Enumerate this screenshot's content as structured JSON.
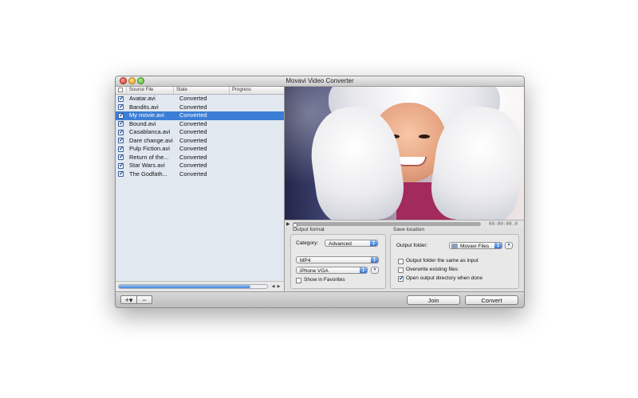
{
  "window": {
    "title": "Movavi Video Converter"
  },
  "list": {
    "headers": {
      "source": "Source File",
      "state": "State",
      "progress": "Progress"
    },
    "rows": [
      {
        "name": "Avatar.avi",
        "state": "Converted",
        "checked": true,
        "selected": false
      },
      {
        "name": "Bandits.avi",
        "state": "Converted",
        "checked": true,
        "selected": false
      },
      {
        "name": "My movie.avi",
        "state": "Converted",
        "checked": true,
        "selected": true
      },
      {
        "name": "Bound.avi",
        "state": "Converted",
        "checked": true,
        "selected": false
      },
      {
        "name": "Casablanca.avi",
        "state": "Converted",
        "checked": true,
        "selected": false
      },
      {
        "name": "Dare change.avi",
        "state": "Converted",
        "checked": true,
        "selected": false
      },
      {
        "name": "Pulp Fiction.avi",
        "state": "Converted",
        "checked": true,
        "selected": false
      },
      {
        "name": "Return of the...",
        "state": "Converted",
        "checked": true,
        "selected": false
      },
      {
        "name": "Star Wars.avi",
        "state": "Converted",
        "checked": true,
        "selected": false
      },
      {
        "name": "The Godfath...",
        "state": "Converted",
        "checked": true,
        "selected": false
      }
    ]
  },
  "player": {
    "time": "00:00:00.0"
  },
  "output_format": {
    "title": "Output format",
    "category_label": "Category:",
    "category_value": "Advanced",
    "format_value": "MP4",
    "preset_value": "iPhone VGA",
    "show_favorites": "Show in Favorites"
  },
  "save_location": {
    "title": "Save location",
    "folder_label": "Output folder:",
    "folder_value": "Movavi Files",
    "opt_same": "Output folder the same as input",
    "opt_overwrite": "Overwrite existing files",
    "opt_open": "Open output directory when done"
  },
  "toolbar": {
    "add": "+▾",
    "remove": "−",
    "join": "Join",
    "convert": "Convert"
  },
  "colors": {
    "selection": "#3c7ed6",
    "accent": "#2f73cf"
  }
}
